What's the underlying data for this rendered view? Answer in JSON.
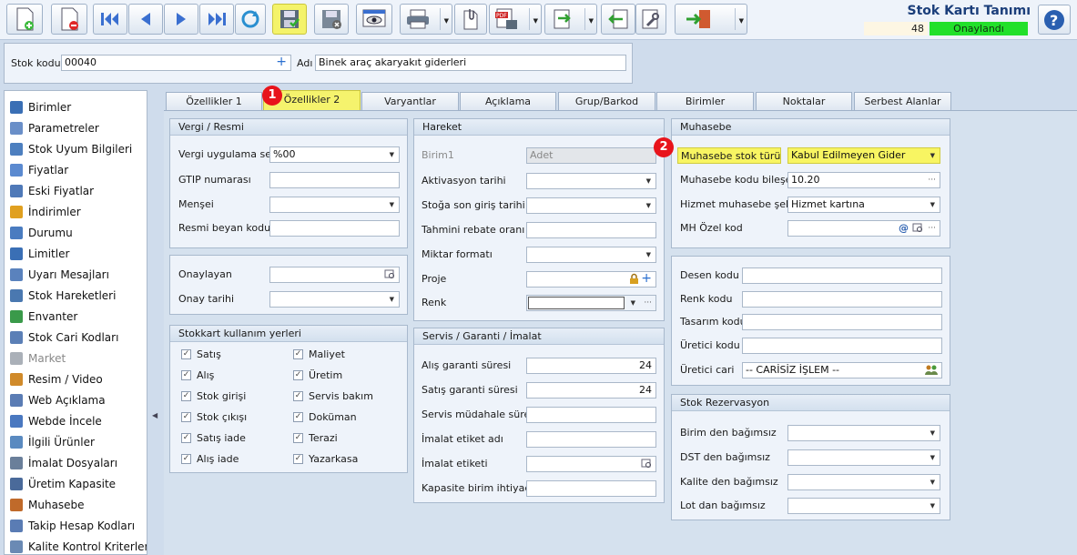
{
  "window": {
    "title": "Stok Kartı Tanımı",
    "record_number": "48",
    "status": "Onaylandı"
  },
  "toolbar": {
    "icons": [
      "new-document-icon",
      "delete-document-icon",
      "first-record-icon",
      "previous-record-icon",
      "next-record-icon",
      "last-record-icon",
      "refresh-icon",
      "save-icon",
      "cancel-save-icon",
      "preview-icon",
      "print-icon",
      "attach-icon",
      "pdf-export-icon",
      "export-icon",
      "import-icon",
      "tools-icon",
      "exit-icon",
      "help-icon"
    ]
  },
  "header": {
    "stock_code_label": "Stok kodu",
    "stock_code_value": "00040",
    "name_label": "Adı",
    "name_value": "Binek araç akaryakıt giderleri"
  },
  "sidebar": {
    "items": [
      {
        "label": "Birimler",
        "color": "#3a6fb5"
      },
      {
        "label": "Parametreler",
        "color": "#6a8fc8"
      },
      {
        "label": "Stok Uyum Bilgileri",
        "color": "#4d7fbf"
      },
      {
        "label": "Fiyatlar",
        "color": "#5b8ad0"
      },
      {
        "label": "Eski Fiyatlar",
        "color": "#4f79b8"
      },
      {
        "label": "İndirimler",
        "color": "#e0a020"
      },
      {
        "label": "Durumu",
        "color": "#4a7cc0"
      },
      {
        "label": "Limitler",
        "color": "#3a6fb5"
      },
      {
        "label": "Uyarı Mesajları",
        "color": "#5a82bd"
      },
      {
        "label": "Stok Hareketleri",
        "color": "#4a78b0"
      },
      {
        "label": "Envanter",
        "color": "#3a9a4a"
      },
      {
        "label": "Stok Cari Kodları",
        "color": "#5b7fb6"
      },
      {
        "label": "Market",
        "color": "#aab0b8"
      },
      {
        "label": "Resim / Video",
        "color": "#d08a2a"
      },
      {
        "label": "Web Açıklama",
        "color": "#5a7cb4"
      },
      {
        "label": "Webde İncele",
        "color": "#4a78c0"
      },
      {
        "label": "İlgili Ürünler",
        "color": "#5a8ac0"
      },
      {
        "label": "İmalat Dosyaları",
        "color": "#6a7f9a"
      },
      {
        "label": "Üretim Kapasite",
        "color": "#4a6a9a"
      },
      {
        "label": "Muhasebe",
        "color": "#c06a2a"
      },
      {
        "label": "Takip Hesap Kodları",
        "color": "#5a7cb4"
      },
      {
        "label": "Kalite Kontrol Kriterleri",
        "color": "#6a8ab4"
      }
    ]
  },
  "tabs": [
    {
      "label": "Özellikler 1"
    },
    {
      "label": "Özellikler 2"
    },
    {
      "label": "Varyantlar"
    },
    {
      "label": "Açıklama"
    },
    {
      "label": "Grup/Barkod"
    },
    {
      "label": "Birimler"
    },
    {
      "label": "Noktalar"
    },
    {
      "label": "Serbest Alanlar"
    }
  ],
  "markers": [
    "1",
    "2"
  ],
  "vergi": {
    "title": "Vergi / Resmi",
    "vat_label": "Vergi uygulama seti",
    "vat_value": "%00",
    "gtip_label": "GTIP numarası",
    "origin_label": "Menşei",
    "customs_label": "Resmi beyan kodu"
  },
  "onay": {
    "approver_label": "Onaylayan",
    "date_label": "Onay tarihi"
  },
  "kullanim": {
    "title": "Stokkart kullanım yerleri",
    "items": [
      {
        "label": "Satış"
      },
      {
        "label": "Alış"
      },
      {
        "label": "Stok girişi"
      },
      {
        "label": "Stok çıkışı"
      },
      {
        "label": "Satış iade"
      },
      {
        "label": "Alış iade"
      },
      {
        "label": "Maliyet"
      },
      {
        "label": "Üretim"
      },
      {
        "label": "Servis bakım"
      },
      {
        "label": "Doküman"
      },
      {
        "label": "Terazi"
      },
      {
        "label": "Yazarkasa"
      }
    ]
  },
  "hareket": {
    "title": "Hareket",
    "unit_label": "Birim1",
    "unit_value": "Adet",
    "activation_label": "Aktivasyon tarihi",
    "last_entry_label": "Stoğa son giriş tarihi",
    "rebate_label": "Tahmini rebate oranı",
    "qty_format_label": "Miktar formatı",
    "project_label": "Proje",
    "color_label": "Renk"
  },
  "servis": {
    "title": "Servis / Garanti / İmalat",
    "purchase_warranty_label": "Alış garanti süresi",
    "purchase_warranty_value": "24",
    "sales_warranty_label": "Satış garanti süresi",
    "sales_warranty_value": "24",
    "service_time_label": "Servis müdahale süresi",
    "production_label_name": "İmalat etiket adı",
    "production_label": "İmalat etiketi",
    "capacity_label": "Kapasite birim ihtiyaç"
  },
  "muhasebe": {
    "title": "Muhasebe",
    "type_label": "Muhasebe stok türü",
    "type_value": "Kabul Edilmeyen Gider",
    "code_part_label": "Muhasebe kodu bileşeni",
    "code_part_value": "10.20",
    "service_label": "Hizmet muhasebe şekli",
    "service_value": "Hizmet kartına",
    "mh_label": "MH Özel kod"
  },
  "desen": {
    "pattern_label": "Desen kodu",
    "color_code_label": "Renk kodu",
    "design_label": "Tasarım kodu",
    "producer_code_label": "Üretici kodu",
    "producer_label": "Üretici cari",
    "producer_value": "-- CARİSİZ İŞLEM --"
  },
  "rezervasyon": {
    "title": "Stok Rezervasyon",
    "unit_label": "Birim den bağımsız",
    "dst_label": "DST den bağımsız",
    "quality_label": "Kalite den bağımsız",
    "lot_label": "Lot dan bağımsız"
  }
}
